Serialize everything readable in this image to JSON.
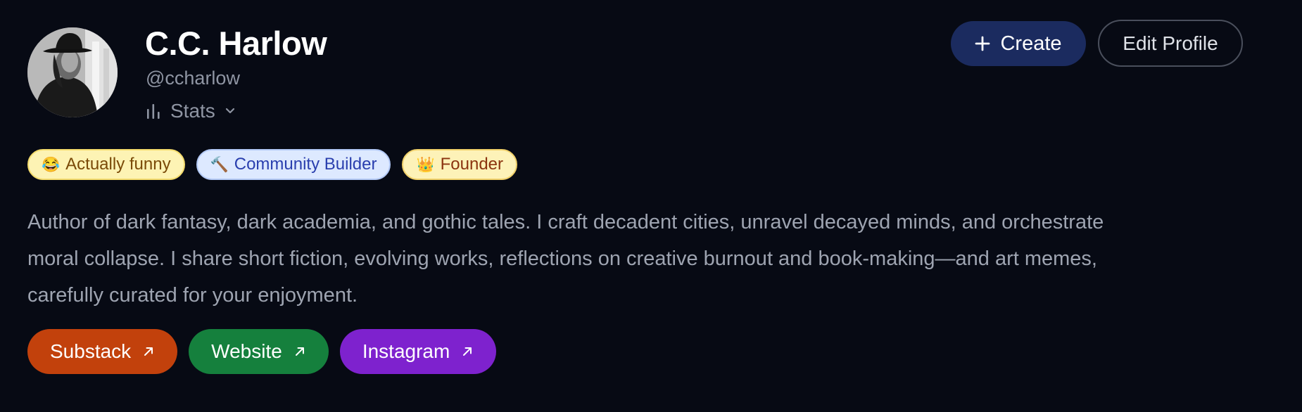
{
  "profile": {
    "name": "C.C. Harlow",
    "handle": "@ccharlow",
    "stats_label": "Stats",
    "avatar_icon": "profile-photo"
  },
  "actions": {
    "create_label": "Create",
    "edit_label": "Edit Profile",
    "create_color": "#1b2b5f"
  },
  "badges": [
    {
      "emoji": "😂",
      "label": "Actually funny",
      "color": "#fdf3b4"
    },
    {
      "emoji": "🔨",
      "label": "Community Builder",
      "color": "#dde9ff"
    },
    {
      "emoji": "👑",
      "label": "Founder",
      "color": "#fdf2b8"
    }
  ],
  "bio": {
    "line1": "Author of dark fantasy, dark academia, and gothic tales. I craft decadent cities, unravel decayed minds, and orchestrate",
    "line2": "moral collapse. I share short fiction, evolving works, reflections on creative burnout and book-making—and art memes,",
    "line3": "carefully curated for your enjoyment."
  },
  "links": [
    {
      "label": "Substack",
      "color": "#c2410c",
      "icon": "external-arrow-icon"
    },
    {
      "label": "Website",
      "color": "#15803d",
      "icon": "external-arrow-icon"
    },
    {
      "label": "Instagram",
      "color": "#7e22ce",
      "icon": "external-arrow-icon"
    }
  ]
}
